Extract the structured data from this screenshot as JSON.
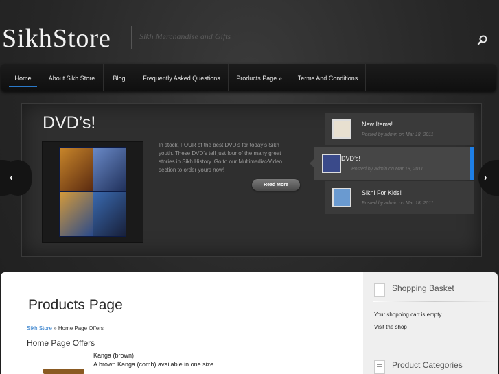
{
  "header": {
    "logo_text": "SikhStore",
    "tagline": "Sikh Merchandise and Gifts"
  },
  "nav": {
    "items": [
      {
        "label": "Home"
      },
      {
        "label": "About Sikh Store"
      },
      {
        "label": "Blog"
      },
      {
        "label": "Frequently Asked Questions"
      },
      {
        "label": "Products Page »"
      },
      {
        "label": "Terms And Conditions"
      }
    ]
  },
  "slider": {
    "title": "DVD’s!",
    "text": "In stock, FOUR of the best DVD’s for today’s Sikh youth. These DVD’s tell just four of the many great stories in Sikh History. Go to our Multimedia>Video section to order yours now!",
    "read_more": "Read More",
    "list": [
      {
        "title": "New Items!",
        "meta": "Posted by admin on Mar 18, 2011"
      },
      {
        "title": "DVD’s!",
        "meta": "Posted by admin on Mar 18, 2011"
      },
      {
        "title": "Sikhi For Kids!",
        "meta": "Posted by admin on Mar 18, 2011"
      }
    ]
  },
  "main": {
    "page_title": "Products Page",
    "breadcrumb": {
      "home": "Sikh Store",
      "sep": " » ",
      "current": "Home Page Offers"
    },
    "section_title": "Home Page Offers",
    "product": {
      "name": "Kanga (brown)",
      "description": "A brown Kanga (comb) available in one size"
    }
  },
  "sidebar": {
    "basket_title": "Shopping Basket",
    "basket_empty": "Your shopping cart is empty",
    "visit_shop": "Visit the shop",
    "categories_title": "Product Categories"
  },
  "colors": {
    "accent": "#1e7fe6",
    "link": "#2a79c9"
  }
}
